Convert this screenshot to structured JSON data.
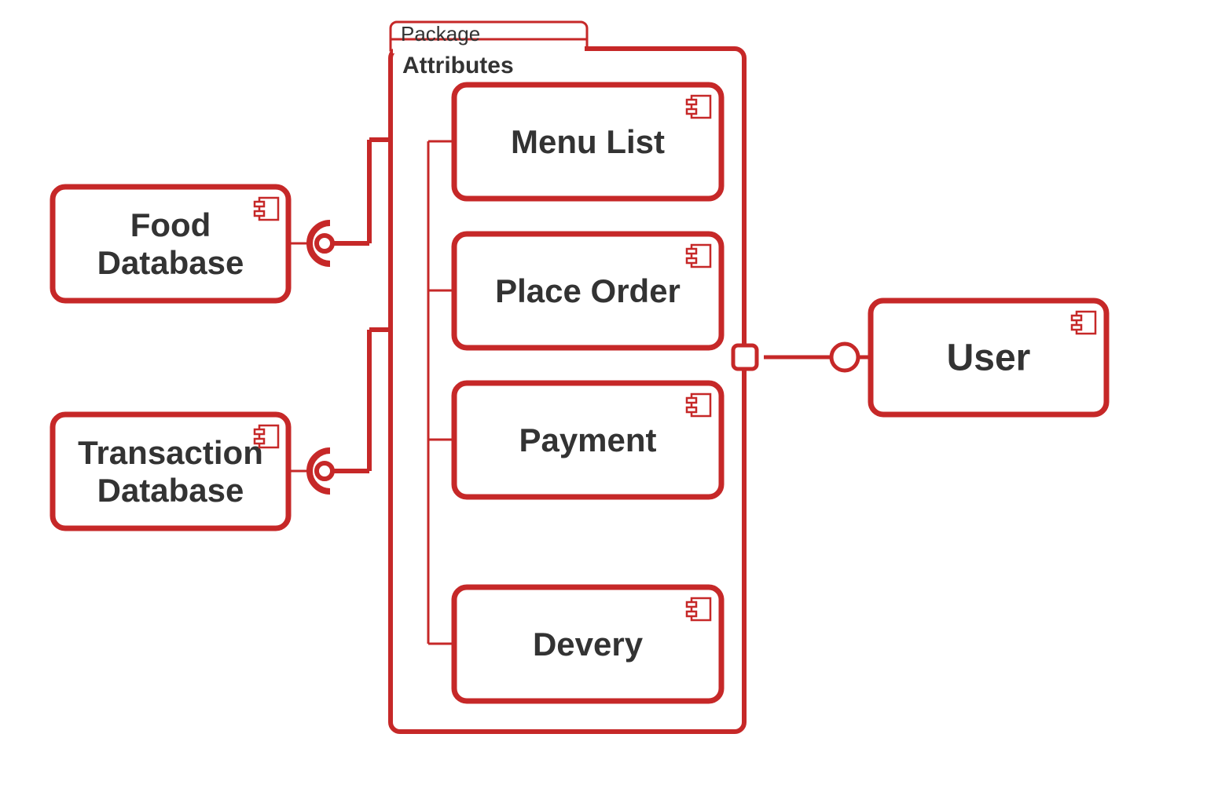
{
  "diagram": {
    "package_tab_label": "Package",
    "package_body_label": "Attributes",
    "components": {
      "food_db_line1": "Food",
      "food_db_line2": "Database",
      "txn_db_line1": "Transaction",
      "txn_db_line2": "Database",
      "menu_list": "Menu List",
      "place_order": "Place Order",
      "payment": "Payment",
      "delivery": "Devery",
      "user": "User"
    },
    "colors": {
      "stroke": "#c62828",
      "text": "#333333",
      "bg": "#ffffff"
    }
  }
}
